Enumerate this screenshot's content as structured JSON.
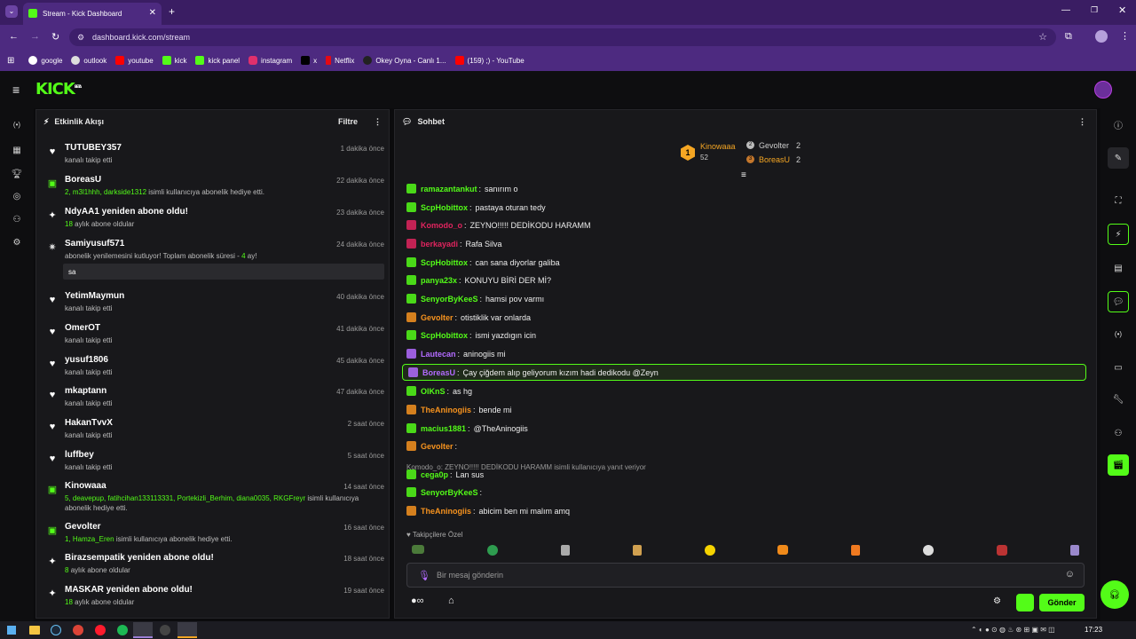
{
  "browser": {
    "tab_title": "Stream - Kick Dashboard",
    "url": "dashboard.kick.com/stream",
    "bookmarks": [
      "google",
      "outlook",
      "youtube",
      "kick",
      "kick panel",
      "instagram",
      "x",
      "Netflix",
      "Okey Oyna - Canlı 1...",
      "(159) ;) - YouTube"
    ]
  },
  "app": {
    "logo": "KICK",
    "logo_badge": "BETA"
  },
  "activity": {
    "title": "Etkinlik Akışı",
    "filter_label": "Filtre",
    "events": [
      {
        "name": "TUTUBEY357",
        "sub": "kanalı takip etti",
        "time": "1 dakika önce",
        "icon": "heart-icon"
      },
      {
        "name": "BoreasU",
        "sub_users": "2, m3l1hhh, darkside1312",
        "sub": "isimli kullanıcıya abonelik hediye etti.",
        "time": "22 dakika önce",
        "icon": "gift-icon"
      },
      {
        "name": "NdyAA1 yeniden abone oldu!",
        "sub_count": "18",
        "sub": "aylık abone oldular",
        "time": "23 dakika önce",
        "icon": "sparkle-icon"
      },
      {
        "name": "Samiyusuf571",
        "sub": "abonelik yenilemesini kutluyor! Toplam abonelik süresi -",
        "sub_months": "4",
        "sub_suffix": "ay!",
        "message": "sa",
        "time": "24 dakika önce",
        "icon": "party-icon"
      },
      {
        "name": "YetimMaymun",
        "sub": "kanalı takip etti",
        "time": "40 dakika önce",
        "icon": "heart-icon"
      },
      {
        "name": "OmerOT",
        "sub": "kanalı takip etti",
        "time": "41 dakika önce",
        "icon": "heart-icon"
      },
      {
        "name": "yusuf1806",
        "sub": "kanalı takip etti",
        "time": "45 dakika önce",
        "icon": "heart-icon"
      },
      {
        "name": "mkaptann",
        "sub": "kanalı takip etti",
        "time": "47 dakika önce",
        "icon": "heart-icon"
      },
      {
        "name": "HakanTvvX",
        "sub": "kanalı takip etti",
        "time": "2 saat önce",
        "icon": "heart-icon"
      },
      {
        "name": "luffbey",
        "sub": "kanalı takip etti",
        "time": "5 saat önce",
        "icon": "heart-icon"
      },
      {
        "name": "Kinowaaa",
        "sub_users": "5, deavepup, fatihcihan133113331, Portekizli_Berhim, diana0035, RKGFreyr",
        "sub": "isimli kullanıcıya abonelik hediye etti.",
        "time": "14 saat önce",
        "icon": "gift-icon"
      },
      {
        "name": "Gevolter",
        "sub_users": "1, Hamza_Eren",
        "sub": "isimli kullanıcıya abonelik hediye etti.",
        "time": "16 saat önce",
        "icon": "gift-icon"
      },
      {
        "name": "Birazsempatik yeniden abone oldu!",
        "sub_count": "8",
        "sub": "aylık abone oldular",
        "time": "18 saat önce",
        "icon": "sparkle-icon"
      },
      {
        "name": "MASKAR yeniden abone oldu!",
        "sub_count": "18",
        "sub": "aylık abone oldular",
        "time": "19 saat önce",
        "icon": "sparkle-icon"
      }
    ]
  },
  "chat": {
    "title": "Sohbet",
    "leaderboard": [
      {
        "rank": "1",
        "name": "Kinowaaa",
        "count": "52"
      },
      {
        "rank": "2",
        "name": "Gevolter",
        "count": "2"
      },
      {
        "rank": "3",
        "name": "BoreasU",
        "count": "2"
      }
    ],
    "messages": [
      {
        "user": "ramazantankut",
        "color": "#53fc18",
        "text": "sanırım o"
      },
      {
        "user": "ScpHobittox",
        "color": "#53fc18",
        "text": "pastaya oturan tedy"
      },
      {
        "user": "Komodo_o",
        "color": "#e0245e",
        "text": "ZEYNO!!!!! DEDİKODU HARAMM"
      },
      {
        "user": "berkayadi",
        "color": "#e0245e",
        "text": "Rafa Silva"
      },
      {
        "user": "ScpHobittox",
        "color": "#53fc18",
        "text": "can sana diyorlar galiba"
      },
      {
        "user": "panya23x",
        "color": "#53fc18",
        "text": "KONUYU BİRİ DER Mİ?"
      },
      {
        "user": "SenyorByKeeS",
        "color": "#53fc18",
        "text": "hamsi pov varmı"
      },
      {
        "user": "Gevolter",
        "color": "#f7931e",
        "text": "otistiklik var onlarda"
      },
      {
        "user": "ScpHobittox",
        "color": "#53fc18",
        "text": "ismi yazdıgın icin"
      },
      {
        "user": "Lautecan",
        "color": "#b36bff",
        "text": "aninogiis mi"
      },
      {
        "user": "BoreasU",
        "color": "#b36bff",
        "text": "Çay çiğdem alıp geliyorum kızım hadi dedikodu @Zeyn"
      },
      {
        "user": "OlKnS",
        "color": "#53fc18",
        "text": "as hg"
      },
      {
        "user": "TheAninogiis",
        "color": "#f7931e",
        "text": "bende mi"
      },
      {
        "user": "macius1881",
        "color": "#53fc18",
        "text": "@TheAninogiis"
      },
      {
        "user": "Gevolter",
        "color": "#f7931e",
        "text": ""
      },
      {
        "user": "cega0p",
        "color": "#53fc18",
        "text": "Lan sus"
      },
      {
        "user": "SenyorByKeeS",
        "color": "#53fc18",
        "text": ""
      },
      {
        "user": "TheAninogiis",
        "color": "#f7931e",
        "text": "abicim ben mi malım amq"
      }
    ],
    "reply_context": "Komodo_o: ZEYNO!!!!! DEDİKODU HARAMM isimli kullanıcıya yanıt veriyor",
    "followers_label": "Takipçilere Özel",
    "input_placeholder": "Bir mesaj gönderin",
    "send_label": "Gönder"
  },
  "taskbar": {
    "time": "17:23"
  },
  "colors": {
    "accent": "#53fc18",
    "browser": "#4d2a80"
  }
}
